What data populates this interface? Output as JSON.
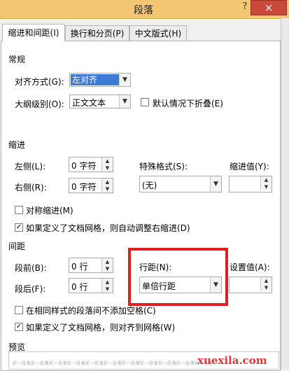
{
  "window": {
    "title": "段落",
    "help_glyph": "?",
    "close_glyph": "×"
  },
  "tabs": [
    {
      "label": "缩进和间距(I)",
      "active": true
    },
    {
      "label": "换行和分页(P)",
      "active": false
    },
    {
      "label": "中文版式(H)",
      "active": false
    }
  ],
  "general": {
    "heading": "常规",
    "alignment_label": "对齐方式(G):",
    "alignment_value": "左对齐",
    "outline_label": "大纲级别(O):",
    "outline_value": "正文文本",
    "collapse_label": "默认情况下折叠(E)",
    "collapse_checked": false
  },
  "indent": {
    "heading": "缩进",
    "left_label": "左侧(L):",
    "left_value": "0 字符",
    "right_label": "右侧(R):",
    "right_value": "0 字符",
    "special_label": "特殊格式(S):",
    "special_value": "(无)",
    "by_label": "缩进值(Y):",
    "by_value": "",
    "mirror_label": "对称缩进(M)",
    "mirror_checked": false,
    "auto_adjust_label": "如果定义了文档网格，则自动调整右缩进(D)",
    "auto_adjust_checked": true
  },
  "spacing": {
    "heading": "间距",
    "before_label": "段前(B):",
    "before_value": "0 行",
    "after_label": "段后(F):",
    "after_value": "0 行",
    "line_label": "行距(N):",
    "line_value": "单倍行距",
    "at_label": "设置值(A):",
    "at_value": "",
    "no_space_label": "在相同样式的段落间不添加空格(C)",
    "no_space_checked": false,
    "snap_grid_label": "如果定义了文档网格，则对齐到网格(W)",
    "snap_grid_checked": true
  },
  "preview": {
    "heading": "预览",
    "sample_text": "前一段落前一段落前一段落前一段落前一段落前一段落前一段落前一段落前一段落前一段落前一段落"
  },
  "watermark": "xuexila.com",
  "colors": {
    "title_bar": "#f3c673",
    "close_button": "#c94a3b",
    "highlight_box": "#e01e1e",
    "watermark": "#d83a3a"
  }
}
